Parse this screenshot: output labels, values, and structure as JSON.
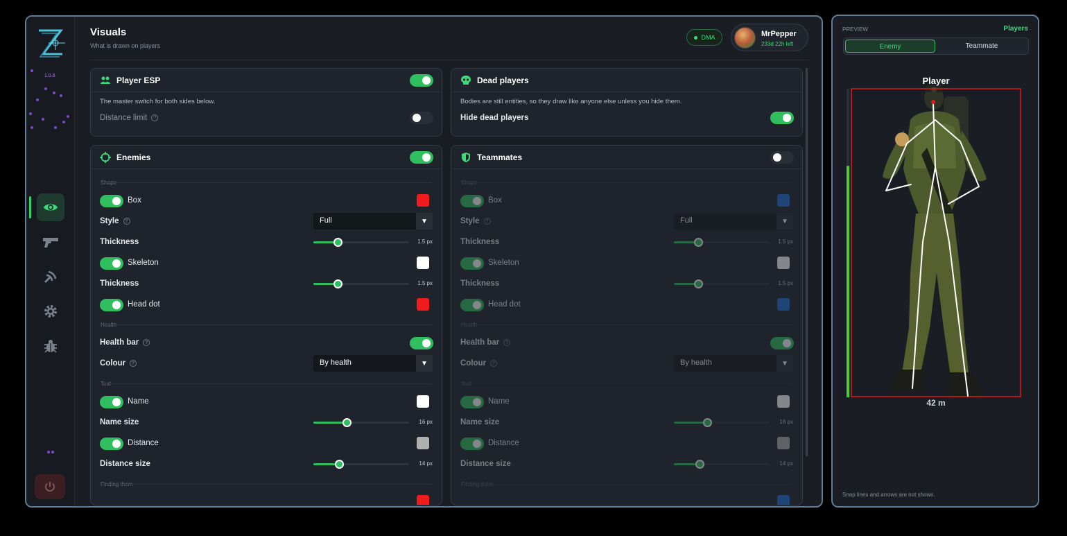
{
  "app": {
    "version": "1.0.6"
  },
  "header": {
    "title": "Visuals",
    "subtitle": "What is drawn on players"
  },
  "status": {
    "dma_label": "DMA",
    "dma_color": "#3ddb78"
  },
  "user": {
    "name": "MrPepper",
    "time_left": "233d 22h left"
  },
  "nav": [
    {
      "name": "visuals",
      "icon": "eye-icon",
      "active": true
    },
    {
      "name": "weapons",
      "icon": "gun-icon",
      "active": false
    },
    {
      "name": "radar",
      "icon": "radar-icon",
      "active": false
    },
    {
      "name": "settings",
      "icon": "gear-icon",
      "active": false
    },
    {
      "name": "debug",
      "icon": "bug-icon",
      "active": false
    }
  ],
  "player_esp": {
    "title": "Player ESP",
    "enabled": true,
    "description": "The master switch for both sides below.",
    "distance_limit_label": "Distance limit",
    "distance_limit": false
  },
  "dead_players": {
    "title": "Dead players",
    "description": "Bodies are still entities, so they draw like anyone else unless you hide them.",
    "hide_label": "Hide dead players",
    "hide": true
  },
  "enemies": {
    "title": "Enemies",
    "enabled": true,
    "shape_section": "Shape",
    "box_label": "Box",
    "box_color": "#f21c1c",
    "style_label": "Style",
    "style_value": "Full",
    "thickness_label": "Thickness",
    "box_thickness": 1.5,
    "box_thickness_text": "1.5 px",
    "skeleton_label": "Skeleton",
    "skeleton_color": "#ffffff",
    "skeleton_thickness": 1.5,
    "skeleton_thickness_text": "1.5 px",
    "headdot_label": "Head dot",
    "headdot_color": "#f21c1c",
    "health_section": "Health",
    "healthbar_label": "Health bar",
    "colour_label": "Colour",
    "colour_value": "By health",
    "text_section": "Text",
    "name_label": "Name",
    "name_color": "#ffffff",
    "namesize_label": "Name size",
    "name_size": 16,
    "name_size_text": "16 px",
    "distance_label": "Distance",
    "distance_color": "#b0b0b0",
    "distsize_label": "Distance size",
    "distance_size": 14,
    "distance_size_text": "14 px",
    "finding_section": "Finding them"
  },
  "teammates": {
    "title": "Teammates",
    "enabled": false,
    "shape_section": "Shape",
    "box_label": "Box",
    "box_color": "#1f6fd6",
    "style_label": "Style",
    "style_value": "Full",
    "thickness_label": "Thickness",
    "box_thickness_text": "1.5 px",
    "skeleton_label": "Skeleton",
    "skeleton_color": "#ffffff",
    "skeleton_thickness_text": "1.5 px",
    "headdot_label": "Head dot",
    "headdot_color": "#1f6fd6",
    "health_section": "Health",
    "healthbar_label": "Health bar",
    "colour_label": "Colour",
    "colour_value": "By health",
    "text_section": "Text",
    "name_label": "Name",
    "name_color": "#ffffff",
    "namesize_label": "Name size",
    "name_size_text": "16 px",
    "distance_label": "Distance",
    "distance_color": "#b0b0b0",
    "distsize_label": "Distance size",
    "distance_size_text": "14 px",
    "finding_section": "Finding them"
  },
  "preview": {
    "label": "PREVIEW",
    "mode": "Players",
    "tabs": [
      "Enemy",
      "Teammate"
    ],
    "player_label": "Player",
    "distance_text": "42 m",
    "health_fraction": 0.75,
    "footer": "Snap lines and arrows are not shown."
  }
}
